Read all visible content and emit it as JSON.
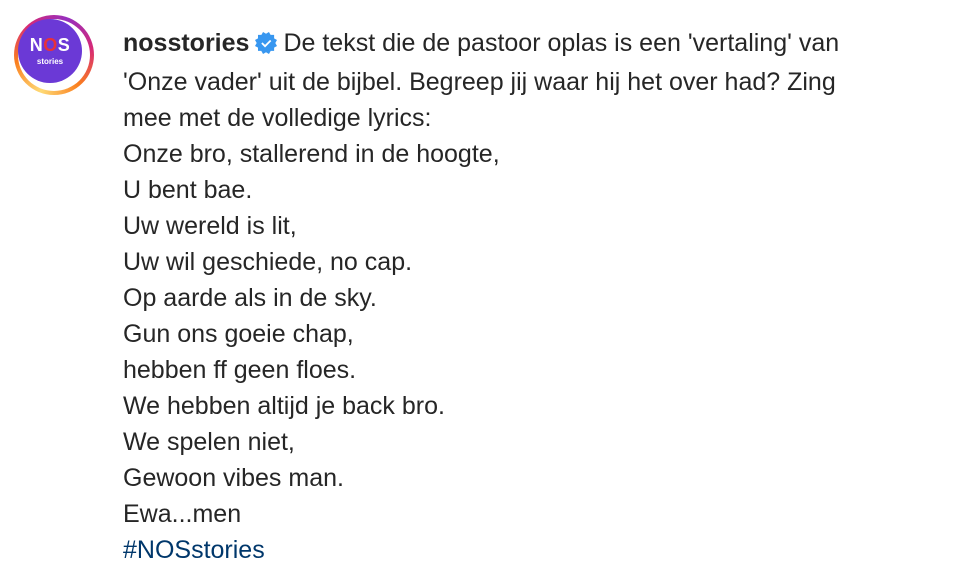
{
  "post": {
    "username": "nosstories",
    "verified_icon": "verified-badge-icon",
    "avatar": {
      "logo_part1": "N",
      "logo_part2": "O",
      "logo_part3": "S",
      "subtitle": "stories",
      "background_color": "#6b39d6",
      "accent_color": "#e8303a"
    },
    "caption_intro_line1": "De tekst die de pastoor oplas is een 'vertaling' van",
    "caption_intro_line2": "'Onze vader' uit de bijbel. Begreep jij waar hij het over had? Zing",
    "caption_intro_line3": "mee met de volledige lyrics:",
    "lyrics": [
      "Onze bro, stallerend in de hoogte,",
      "U bent bae.",
      "Uw wereld is lit,",
      "Uw wil geschiede, no cap.",
      "Op aarde als in de sky.",
      "Gun ons goeie chap,",
      "hebben ff geen floes.",
      "We hebben altijd je back bro.",
      "We spelen niet,",
      "Gewoon vibes man.",
      "Ewa...men"
    ],
    "hashtag": "#NOSstories",
    "colors": {
      "text": "#262626",
      "hashtag": "#00376b",
      "verified": "#3897f0"
    }
  }
}
